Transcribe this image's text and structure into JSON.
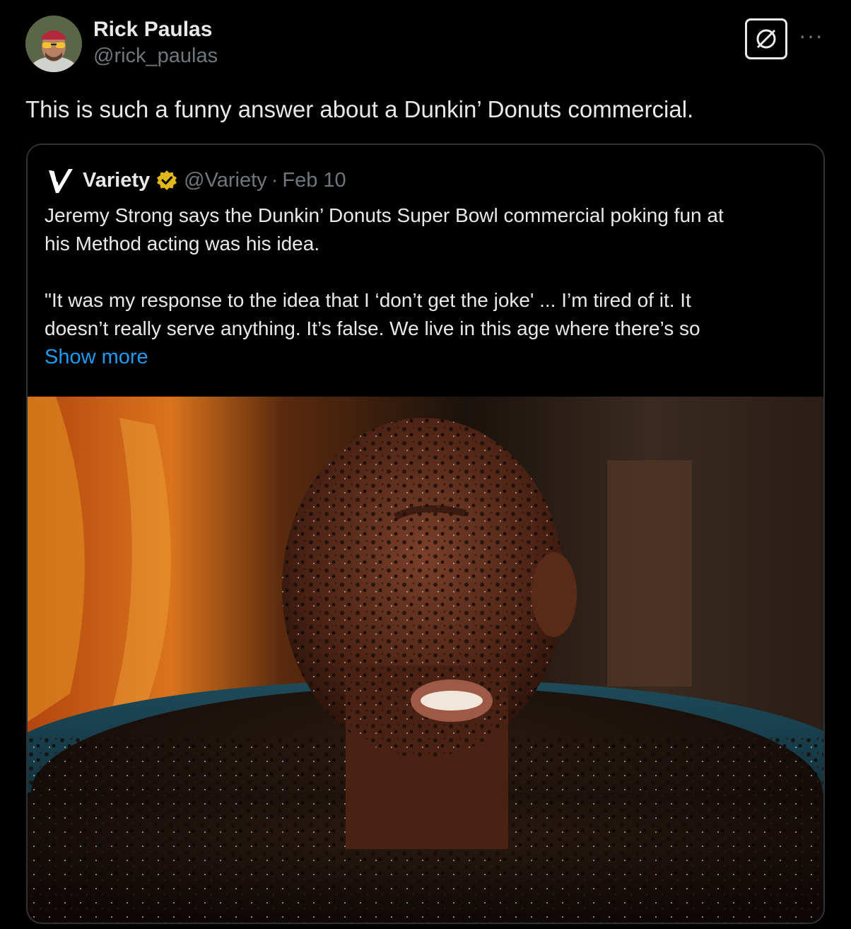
{
  "author": {
    "display_name": "Rick Paulas",
    "handle": "@rick_paulas",
    "avatar_icon": "avatar-photo"
  },
  "actions": {
    "grok_icon": "grok-slash-circle-icon",
    "more_label": "···"
  },
  "tweet": {
    "text": "This is such a funny answer about a Dunkin’ Donuts commercial."
  },
  "quoted": {
    "name": "Variety",
    "handle": "@Variety",
    "separator": "·",
    "date": "Feb 10",
    "logo_icon": "variety-v-logo-icon",
    "verified_icon": "gold-verified-badge-icon",
    "paragraph1": "Jeremy Strong says the Dunkin’ Donuts Super Bowl commercial poking fun at\nhis Method acting was his idea.",
    "paragraph2": "\"It was my response to the idea that I ‘don’t get the joke' ... I’m tired of it. It\ndoesn’t really serve anything. It’s false. We live in this age where there’s so",
    "show_more": "Show more",
    "media_icon": "commercial-still-image"
  },
  "colors": {
    "background": "#000000",
    "text": "#e7e9ea",
    "muted": "#71767b",
    "link": "#1d9bf0",
    "border": "#2f3336",
    "verified_gold": "#e2b719"
  }
}
